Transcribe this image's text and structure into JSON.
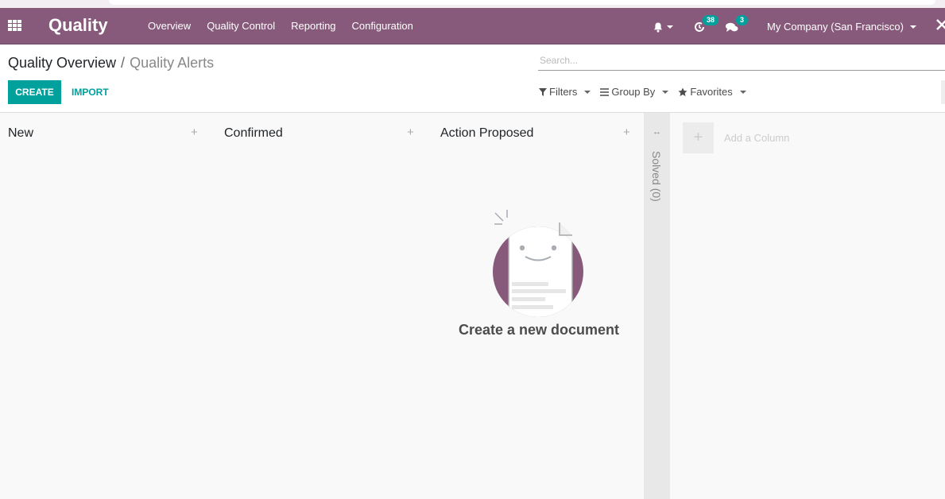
{
  "navbar": {
    "app_title": "Quality",
    "menu": [
      "Overview",
      "Quality Control",
      "Reporting",
      "Configuration"
    ],
    "activity_count": "38",
    "messages_count": "3",
    "company": "My Company (San Francisco)",
    "icons": [
      "apps-grid-icon",
      "bell-icon",
      "clock-icon",
      "chat-icon",
      "tools-icon"
    ]
  },
  "breadcrumb": {
    "parent": "Quality Overview",
    "separator": "/",
    "current": "Quality Alerts"
  },
  "buttons": {
    "create": "CREATE",
    "import": "IMPORT"
  },
  "search": {
    "placeholder": "Search...",
    "value": ""
  },
  "filters": {
    "filters": "Filters",
    "group_by": "Group By",
    "favorites": "Favorites"
  },
  "kanban": {
    "columns": [
      {
        "title": "New"
      },
      {
        "title": "Confirmed"
      },
      {
        "title": "Action Proposed"
      }
    ],
    "folded_column": "Solved (0)",
    "add_column": "Add a Column",
    "help_title": "Create a new document"
  },
  "colors": {
    "brand": "#875a7b",
    "accent": "#00a09d"
  }
}
